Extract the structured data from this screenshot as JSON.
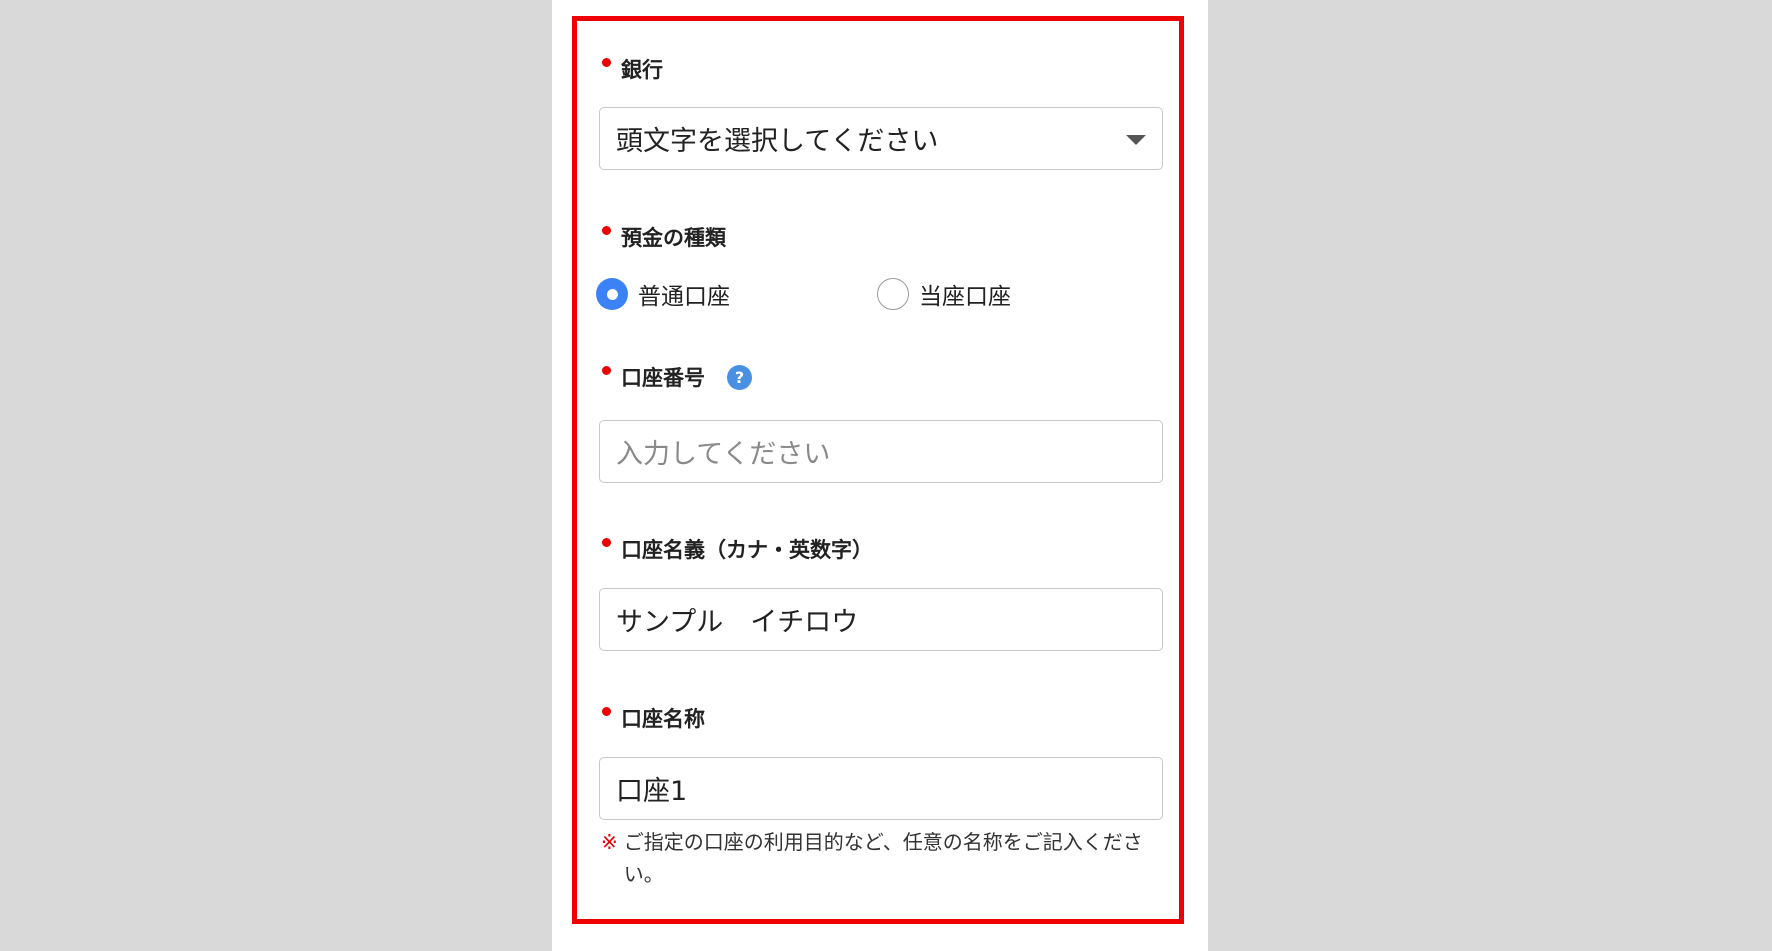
{
  "form": {
    "bank": {
      "label": "銀行",
      "select_value": "頭文字を選択してください"
    },
    "deposit_type": {
      "label": "預金の種類",
      "options": [
        {
          "label": "普通口座",
          "selected": true
        },
        {
          "label": "当座口座",
          "selected": false
        }
      ]
    },
    "account_number": {
      "label": "口座番号",
      "help_glyph": "?",
      "placeholder": "入力してください"
    },
    "account_holder": {
      "label": "口座名義（カナ・英数字）",
      "value": "サンプル　イチロウ"
    },
    "account_name": {
      "label": "口座名称",
      "value": "口座1"
    },
    "note": {
      "mark": "※",
      "text": "ご指定の口座の利用目的など、任意の名称をご記入ください。"
    }
  },
  "colors": {
    "required_marker": "#ee0000",
    "highlight_frame": "#ee0000",
    "radio_selected": "#3b82f6",
    "help_icon": "#4a90e2"
  },
  "icons": {
    "select_arrow": "triangle-down-icon",
    "help": "question-circle-icon"
  }
}
